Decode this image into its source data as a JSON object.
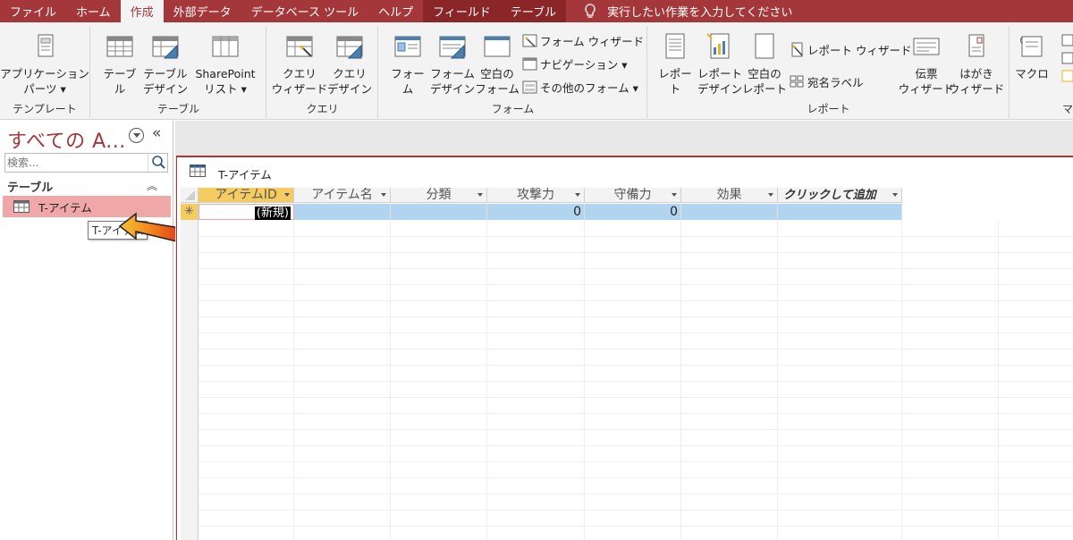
{
  "tabs": [
    {
      "label": "ファイル",
      "active": false
    },
    {
      "label": "ホーム",
      "active": false
    },
    {
      "label": "作成",
      "active": true
    },
    {
      "label": "外部データ",
      "active": false
    },
    {
      "label": "データベース ツール",
      "active": false
    },
    {
      "label": "ヘルプ",
      "active": false
    },
    {
      "label": "フィールド",
      "active": false,
      "contextual": true
    },
    {
      "label": "テーブル",
      "active": false,
      "contextual": true
    }
  ],
  "tell_me": "実行したい作業を入力してください",
  "ribbon": {
    "templates": {
      "label": "テンプレート",
      "app_parts": "アプリケーション\nパーツ ▾"
    },
    "tables": {
      "label": "テーブル",
      "table": "テーブル",
      "table_design": "テーブル\nデザイン",
      "sharepoint": "SharePoint\nリスト ▾"
    },
    "queries": {
      "label": "クエリ",
      "query_wizard": "クエリ\nウィザード",
      "query_design": "クエリ\nデザイン"
    },
    "forms": {
      "label": "フォーム",
      "form": "フォーム",
      "form_design": "フォーム\nデザイン",
      "blank_form": "空白の\nフォーム",
      "form_wizard": "フォーム ウィザード",
      "navigation": "ナビゲーション ▾",
      "more_forms": "その他のフォーム ▾"
    },
    "reports": {
      "label": "レポート",
      "report": "レポート",
      "report_design": "レポート\nデザイン",
      "blank_report": "空白の\nレポート",
      "report_wizard": "レポート ウィザード",
      "labels": "宛名ラベル",
      "slip_wizard": "伝票\nウィザード",
      "postcard_wizard": "はがき\nウィザード"
    },
    "macros": {
      "macro": "マクロ",
      "label_partial": "マ"
    }
  },
  "nav": {
    "title": "すべての A...",
    "search_placeholder": "検索...",
    "group": "テーブル",
    "item": "T-アイテム",
    "tooltip": "T-アイテム"
  },
  "document": {
    "title": "T-アイテム",
    "columns": [
      "アイテムID",
      "アイテム名",
      "分類",
      "攻撃力",
      "守備力",
      "効果",
      "クリックして追加"
    ],
    "new_row": {
      "selector": "✳",
      "id": "(新規)",
      "attack": "0",
      "defense": "0"
    }
  },
  "colors": {
    "accent": "#a4373a",
    "selected_header": "#f5cc61",
    "row_highlight": "#b1d4ef",
    "nav_highlight": "#f0a7a8"
  }
}
